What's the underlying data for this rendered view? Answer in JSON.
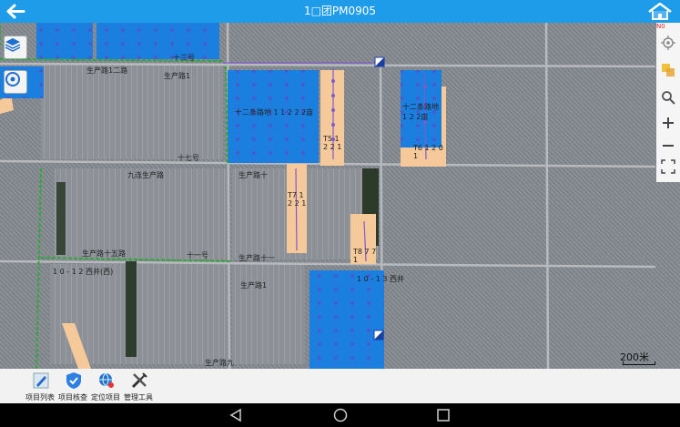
{
  "header": {
    "title": "1□团PM0905",
    "back_icon": "back-arrow-icon",
    "home_icon": "home-icon"
  },
  "map": {
    "labels": {
      "road1": "生产路1二路",
      "road2": "生产路1",
      "road3": "十三号",
      "field_a": "十二条路地 1 1 2 2 2亩",
      "field_b": "十二条路地 1 2 2亩",
      "field_c": "十七号",
      "field_d": "九连生产路",
      "field_e": "生产路十",
      "road4": "生产路十一",
      "road5": "十一号",
      "road6": "生产路十五路",
      "road7": "1 0 - 1 2 西井(西)",
      "road8": "生产路1",
      "road9": "生产路九",
      "road10": "1 0 - 1 3 西井",
      "well1": "T5 1 2 2 1",
      "well2": "T6 1 2 0 1",
      "well3": "T7 1 2 2 1",
      "well4": "T8 7 7 1"
    },
    "scale_text": "200米",
    "badge_text": "N0"
  },
  "right_tools": [
    "locate-icon",
    "layers-icon",
    "search-icon",
    "zoom-in-icon",
    "zoom-out-icon",
    "fullscreen-icon"
  ],
  "toolbar": {
    "items": [
      {
        "label": "项目列表",
        "icon": "pen-icon"
      },
      {
        "label": "项目核查",
        "icon": "shield-check-icon"
      },
      {
        "label": "定位项目",
        "icon": "globe-locate-icon"
      },
      {
        "label": "管理工具",
        "icon": "tools-icon"
      }
    ]
  },
  "colors": {
    "topbar": "#1e9be9",
    "field_blue": "#1b7fe0",
    "field_sand": "#f5c99a",
    "boundary_green": "#2fa83a",
    "pipeline_purple": "#7d5ccc"
  }
}
